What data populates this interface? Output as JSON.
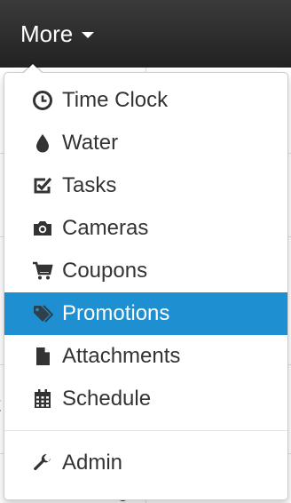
{
  "navbar": {
    "more_label": "More"
  },
  "background": {
    "fragment_left": "t",
    "fragment_bottom": "g"
  },
  "menu": {
    "items": [
      {
        "label": "Time Clock",
        "icon": "clock-icon"
      },
      {
        "label": "Water",
        "icon": "water-drop-icon"
      },
      {
        "label": "Tasks",
        "icon": "checkbox-icon"
      },
      {
        "label": "Cameras",
        "icon": "camera-icon"
      },
      {
        "label": "Coupons",
        "icon": "shopping-cart-icon"
      },
      {
        "label": "Promotions",
        "icon": "tags-icon",
        "active": true
      },
      {
        "label": "Attachments",
        "icon": "file-icon"
      },
      {
        "label": "Schedule",
        "icon": "calendar-icon"
      }
    ],
    "admin": {
      "label": "Admin",
      "icon": "wrench-icon"
    }
  },
  "colors": {
    "navbar": "#222222",
    "active": "#1e8fd0",
    "text": "#333333"
  }
}
